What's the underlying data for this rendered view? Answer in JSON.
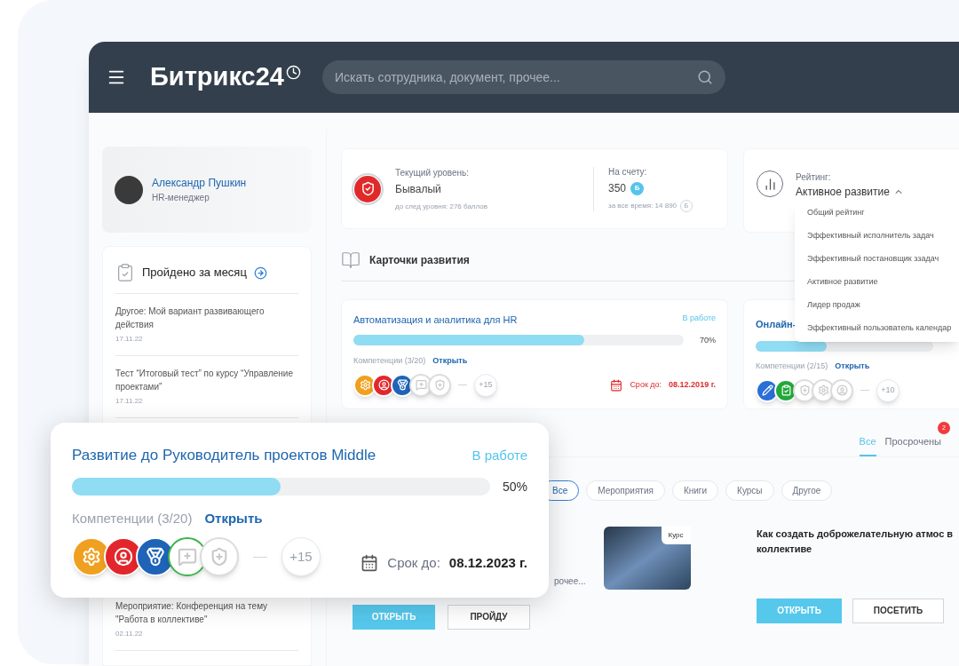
{
  "header": {
    "logo": "Битрикс24",
    "search": {
      "placeholder": "Искать сотрудника, документ, прочее..."
    }
  },
  "profile": {
    "name": "Александр Пушкин",
    "role": "HR-менеджер"
  },
  "monthly": {
    "title": "Пройдено за месяц",
    "items": [
      {
        "text": "Другое: Мой вариант развивающего действия",
        "date": "17.11.22"
      },
      {
        "text": "Тест “Итоговый тест” по курсу “Управление проектами”",
        "date": "17.11.22"
      },
      {
        "text": "Мероприятие: Конференция на тему \"Работа в коллективе\"",
        "date": "02.11.22"
      }
    ]
  },
  "level": {
    "label": "Текущий уровень:",
    "value": "Бывалый",
    "next": "до след уровня: 276 баллов",
    "balance_label": "На счету:",
    "balance": "350",
    "currency": "Б",
    "total": "за все время: 14 890",
    "total_currency": "Б"
  },
  "rating": {
    "label": "Рейтинг:",
    "value": "Активное развитие",
    "expanded": true,
    "options": [
      "Общий рейтинг",
      "Эффективный исполнитель задач",
      "Эффективный постановщик ззадач",
      "Активное развитие",
      "Лидер продаж",
      "Эффективный пользователь календар"
    ]
  },
  "cards_title": "Карточки развития",
  "cards": [
    {
      "title": "Автоматизация и аналитика для HR",
      "status": "В работе",
      "level": 0.7,
      "percent": "70%",
      "competencies": "Компетенции (3/20)",
      "open": "Открыть",
      "more": "+15",
      "due_label": "Срок до:",
      "due": "08.12.2019 г.",
      "overdue": true,
      "badges": [
        {
          "kind": "gear",
          "earned": true,
          "color": "#f0a020"
        },
        {
          "kind": "person",
          "earned": true,
          "color": "#e3262b"
        },
        {
          "kind": "medal",
          "earned": true,
          "color": "#1e63b8"
        },
        {
          "kind": "note",
          "earned": false,
          "color": "#dcdcdc"
        },
        {
          "kind": "shield",
          "earned": false,
          "color": "#dcdcdc"
        }
      ]
    },
    {
      "title": "Онлайн-",
      "level": 0.4,
      "competencies": "Компетенции (2/15)",
      "open": "Открыть",
      "more": "+10",
      "badges": [
        {
          "kind": "pencil",
          "earned": true,
          "color": "#2a6fd6"
        },
        {
          "kind": "check",
          "earned": true,
          "color": "#22a83a"
        },
        {
          "kind": "shield",
          "earned": false,
          "color": "#dcdcdc"
        },
        {
          "kind": "gear",
          "earned": false,
          "color": "#dcdcdc"
        },
        {
          "kind": "person",
          "earned": false,
          "color": "#dcdcdc"
        }
      ]
    }
  ],
  "tabs": [
    {
      "label": "Все",
      "selected": true
    },
    {
      "label": "Просрочены",
      "selected": false,
      "count": "2"
    }
  ],
  "filters": [
    {
      "label": "Все",
      "selected": true
    },
    {
      "label": "Мероприятия",
      "selected": false
    },
    {
      "label": "Книги",
      "selected": false
    },
    {
      "label": "Курсы",
      "selected": false
    },
    {
      "label": "Другое",
      "selected": false
    }
  ],
  "courses": [
    {
      "snippet": "рочее...",
      "tag": "Курс",
      "buttons": [
        "ОТКРЫТЬ",
        "ПРОЙДУ"
      ]
    },
    {
      "title": "Как создать доброжелательную атмос в коллективе",
      "buttons": [
        "ОТКРЫТЬ",
        "ПОСЕТИТЬ"
      ]
    }
  ],
  "overlay": {
    "title": "Развитие до Руководитель проектов Middle",
    "status": "В работе",
    "level": 0.5,
    "percent": "50%",
    "competencies": "Компетенции (3/20)",
    "open": "Открыть",
    "more": "+15",
    "due_label": "Срок до:",
    "due": "08.12.2023 г.",
    "overdue": false,
    "badges": [
      {
        "kind": "gear",
        "earned": true,
        "color": "#f0a020"
      },
      {
        "kind": "person",
        "earned": true,
        "color": "#e3262b"
      },
      {
        "kind": "medal",
        "earned": true,
        "color": "#1e63b8"
      },
      {
        "kind": "note",
        "earned": false,
        "color": "#3cb34a"
      },
      {
        "kind": "shield",
        "earned": false,
        "color": "#dcdcdc"
      }
    ]
  }
}
